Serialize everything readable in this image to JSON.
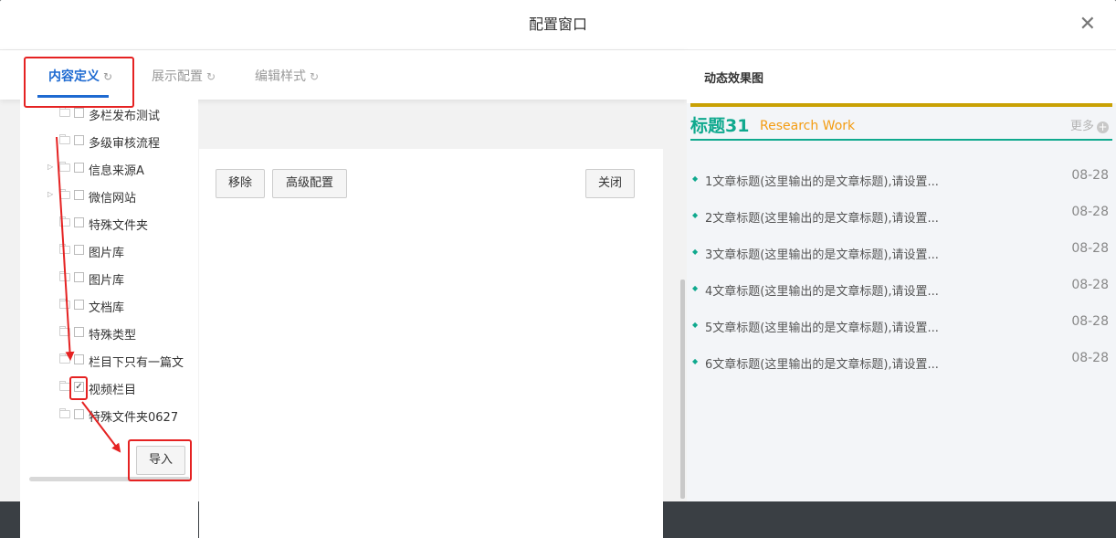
{
  "modal": {
    "title": "配置窗口",
    "close_icon": "close-icon"
  },
  "tabs": [
    {
      "label": "内容定义",
      "active": true
    },
    {
      "label": "展示配置",
      "active": false
    },
    {
      "label": "编辑样式",
      "active": false
    }
  ],
  "tree": {
    "items": [
      {
        "label": "多栏发布测试",
        "expandable": false,
        "checked": false
      },
      {
        "label": "多级审核流程",
        "expandable": false,
        "checked": false
      },
      {
        "label": "信息来源A",
        "expandable": true,
        "checked": false
      },
      {
        "label": "微信网站",
        "expandable": true,
        "checked": false
      },
      {
        "label": "特殊文件夹",
        "expandable": false,
        "checked": false
      },
      {
        "label": "图片库",
        "expandable": false,
        "checked": false
      },
      {
        "label": "图片库",
        "expandable": false,
        "checked": false
      },
      {
        "label": "文档库",
        "expandable": false,
        "checked": false
      },
      {
        "label": "特殊类型",
        "expandable": false,
        "checked": false
      },
      {
        "label": "栏目下只有一篇文",
        "expandable": false,
        "checked": false
      },
      {
        "label": "视频栏目",
        "expandable": false,
        "checked": true
      },
      {
        "label": "特殊文件夹0627",
        "expandable": false,
        "checked": false
      }
    ],
    "check_mark": "✓",
    "import_label": "导入"
  },
  "ops": {
    "remove_label": "移除",
    "advanced_label": "高级配置",
    "close_label": "关闭"
  },
  "preview": {
    "header": "动态效果图",
    "title": "标题31",
    "subtitle": "Research Work",
    "more": "更多",
    "more_plus": "+",
    "articles": [
      {
        "title": "1文章标题(这里输出的是文章标题),请设置...",
        "date": "08-28"
      },
      {
        "title": "2文章标题(这里输出的是文章标题),请设置...",
        "date": "08-28"
      },
      {
        "title": "3文章标题(这里输出的是文章标题),请设置...",
        "date": "08-28"
      },
      {
        "title": "4文章标题(这里输出的是文章标题),请设置...",
        "date": "08-28"
      },
      {
        "title": "5文章标题(这里输出的是文章标题),请设置...",
        "date": "08-28"
      },
      {
        "title": "6文章标题(这里输出的是文章标题),请设置...",
        "date": "08-28"
      }
    ]
  },
  "colors": {
    "accent_blue": "#1e6ad1",
    "annotation_red": "#e52222",
    "teal": "#0fa98e",
    "gold": "#c9a104",
    "orange": "#f39c12"
  }
}
